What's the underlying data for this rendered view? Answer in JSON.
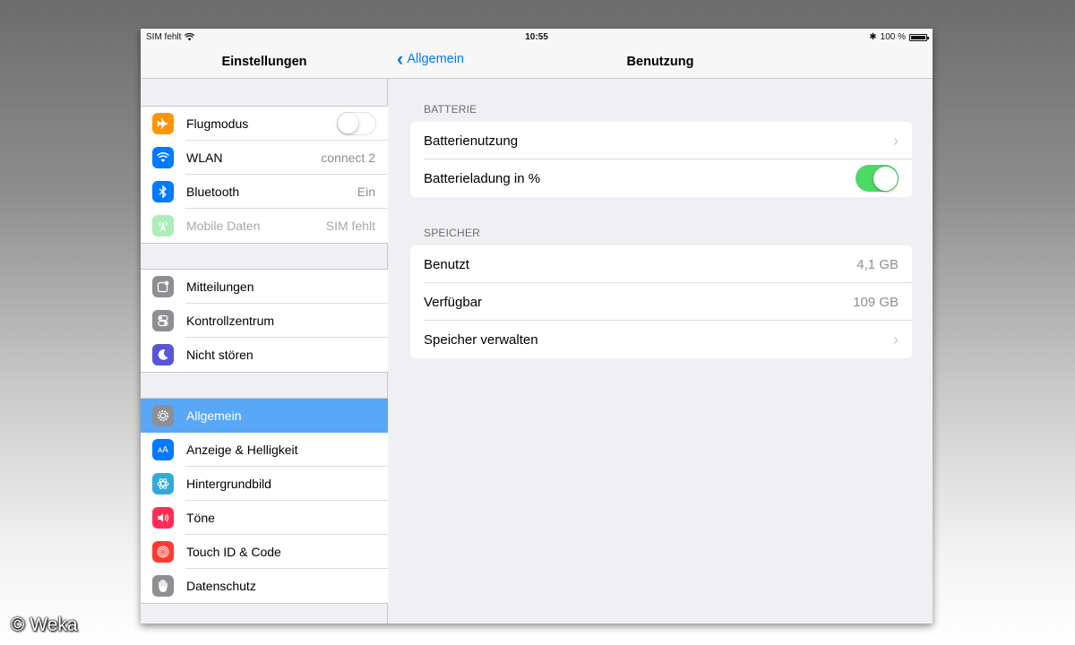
{
  "status_bar": {
    "carrier": "SIM fehlt",
    "time": "10:55",
    "battery_text": "100 %",
    "battery_level": 1.0
  },
  "master": {
    "title": "Einstellungen",
    "groups": [
      {
        "items": [
          {
            "label": "Flugmodus",
            "icon": "airplane-icon",
            "color": "#ff9500",
            "control": "toggle",
            "toggle_on": false
          },
          {
            "label": "WLAN",
            "icon": "wifi-icon",
            "color": "#007aff",
            "value": "connect 2"
          },
          {
            "label": "Bluetooth",
            "icon": "bluetooth-icon",
            "color": "#007aff",
            "value": "Ein"
          },
          {
            "label": "Mobile Daten",
            "icon": "antenna-icon",
            "color": "#4cd964",
            "value": "SIM fehlt",
            "disabled": true
          }
        ]
      },
      {
        "items": [
          {
            "label": "Mitteilungen",
            "icon": "notifications-icon",
            "color": "#8e8e93"
          },
          {
            "label": "Kontrollzentrum",
            "icon": "control-center-icon",
            "color": "#8e8e93"
          },
          {
            "label": "Nicht stören",
            "icon": "moon-icon",
            "color": "#5856d6"
          }
        ]
      },
      {
        "items": [
          {
            "label": "Allgemein",
            "icon": "gear-icon",
            "color": "#8e8e93",
            "selected": true
          },
          {
            "label": "Anzeige & Helligkeit",
            "icon": "display-icon",
            "color": "#007aff"
          },
          {
            "label": "Hintergrundbild",
            "icon": "wallpaper-icon",
            "color": "#34aadc"
          },
          {
            "label": "Töne",
            "icon": "speaker-icon",
            "color": "#ff2d55"
          },
          {
            "label": "Touch ID & Code",
            "icon": "fingerprint-icon",
            "color": "#ff3b30"
          },
          {
            "label": "Datenschutz",
            "icon": "hand-icon",
            "color": "#8e8e93"
          }
        ]
      }
    ]
  },
  "detail": {
    "back_label": "Allgemein",
    "title": "Benutzung",
    "sections": [
      {
        "header": "BATTERIE",
        "rows": [
          {
            "label": "Batterienutzung",
            "accessory": "chevron"
          },
          {
            "label": "Batterieladung in %",
            "accessory": "toggle",
            "toggle_on": true
          }
        ]
      },
      {
        "header": "SPEICHER",
        "rows": [
          {
            "label": "Benutzt",
            "value": "4,1 GB"
          },
          {
            "label": "Verfügbar",
            "value": "109 GB"
          },
          {
            "label": "Speicher verwalten",
            "accessory": "chevron"
          }
        ]
      }
    ]
  },
  "watermark": "© Weka"
}
